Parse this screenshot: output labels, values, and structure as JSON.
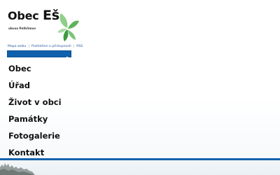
{
  "logo": {
    "title_word": "Obec",
    "title_name": "Eš",
    "subtitle": "obvos Pelhřimov",
    "colors": {
      "leaf_dark": "#3f9a3f",
      "leaf_light": "#8ed08a"
    },
    "icon": "leaves-icon"
  },
  "quicklinks": [
    {
      "label": "Mapa webu"
    },
    {
      "label": "Prohlášení o přístupnosti"
    },
    {
      "label": "RSS"
    }
  ],
  "search": {
    "placeholder": "",
    "value": "",
    "icon": "search-icon"
  },
  "menu": {
    "items": [
      {
        "label": "Obec"
      },
      {
        "label": "Úřad"
      },
      {
        "label": "Život v obci"
      },
      {
        "label": "Památky"
      },
      {
        "label": "Fotogalerie"
      },
      {
        "label": "Kontakt"
      }
    ]
  },
  "colors": {
    "accent": "#1462ae",
    "search_bg": "#0f60ad",
    "link": "#2a5aa0",
    "text": "#111111"
  }
}
